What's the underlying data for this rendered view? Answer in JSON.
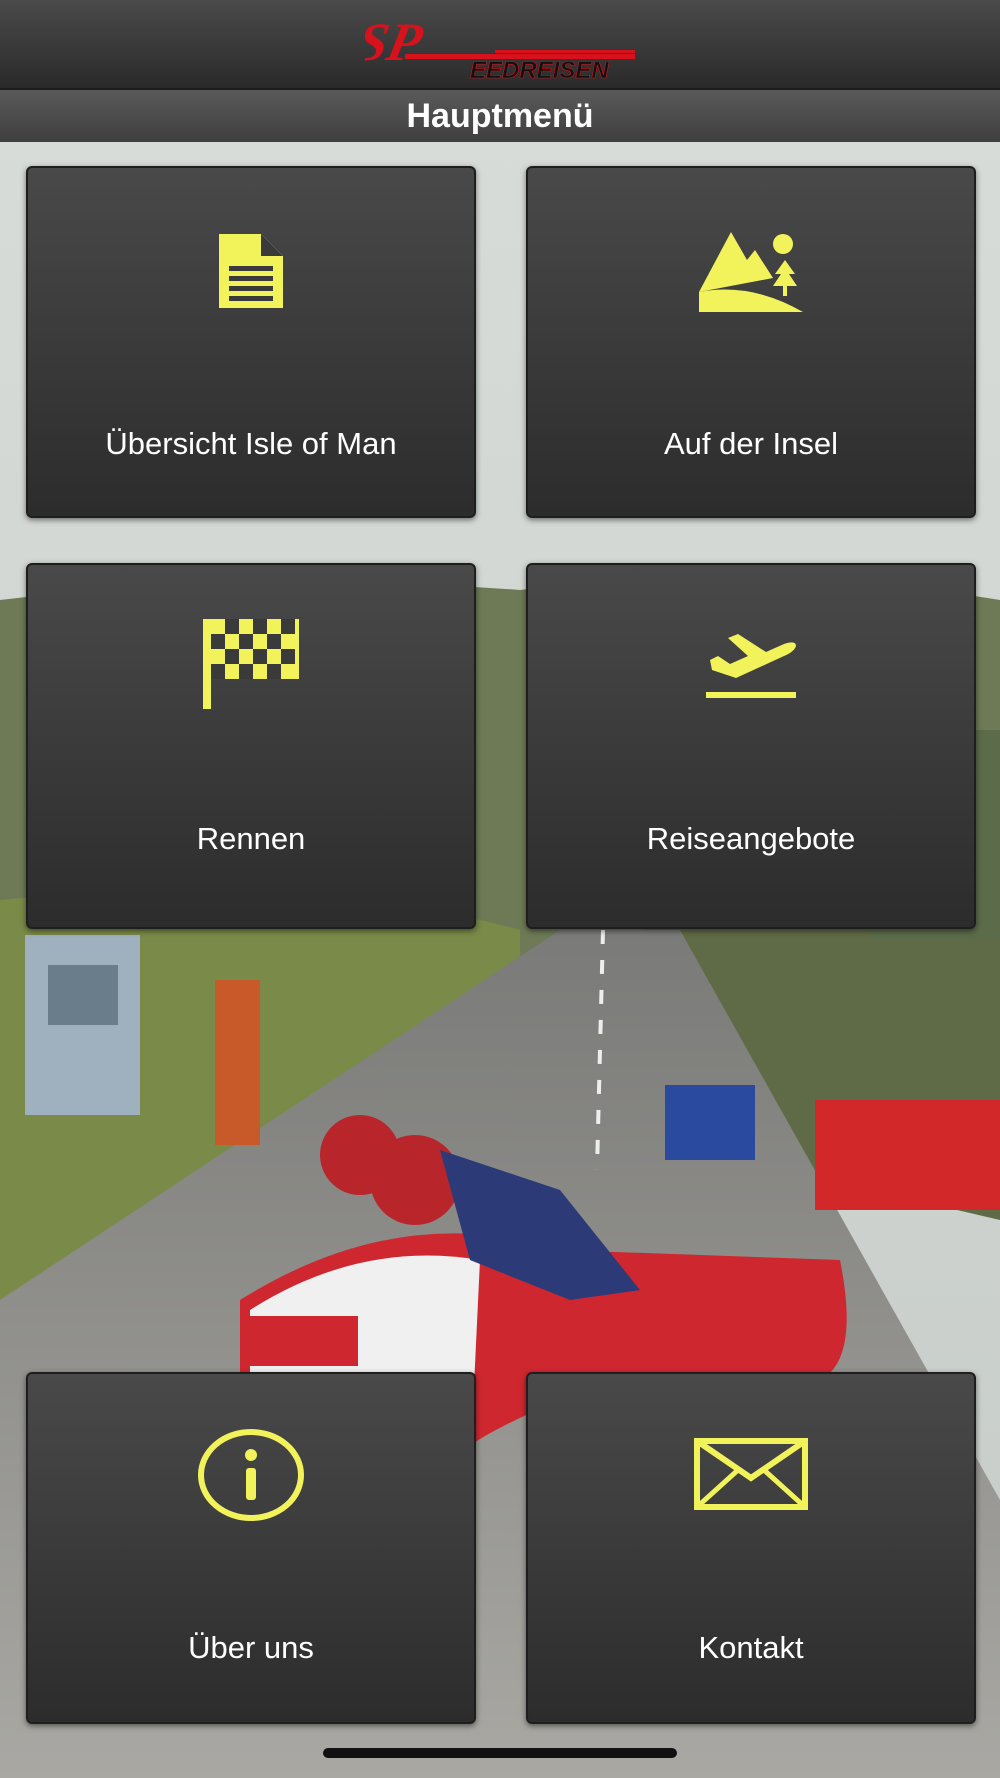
{
  "header": {
    "logo_text_sp": "SP",
    "logo_text": "EEDREISEN",
    "title": "Hauptmenü"
  },
  "menu": [
    {
      "label": "Übersicht Isle of Man",
      "icon": "document-icon"
    },
    {
      "label": "Auf der Insel",
      "icon": "landscape-icon"
    },
    {
      "label": "Rennen",
      "icon": "checkered-flag-icon"
    },
    {
      "label": "Reiseangebote",
      "icon": "airplane-departure-icon"
    },
    {
      "label": "Über uns",
      "icon": "info-icon"
    },
    {
      "label": "Kontakt",
      "icon": "envelope-icon"
    }
  ],
  "colors": {
    "accent": "#f2f25a",
    "logo_red": "#d8121c",
    "tile_bg": "#3a3a3a"
  }
}
